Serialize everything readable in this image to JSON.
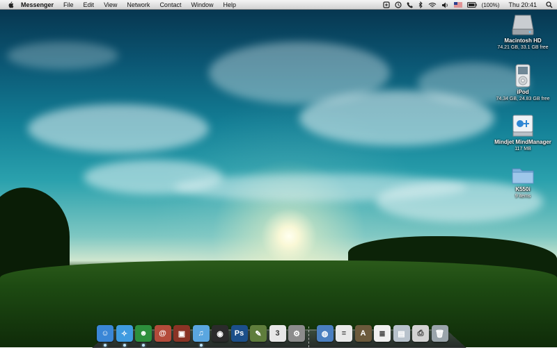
{
  "menubar": {
    "app_name": "Messenger",
    "menus": [
      "File",
      "Edit",
      "View",
      "Network",
      "Contact",
      "Window",
      "Help"
    ],
    "battery_label": "(100%)",
    "clock": "Thu 20:41"
  },
  "desktop_icons": [
    {
      "name": "Macintosh HD",
      "sub": "74.21 GB, 33.1 GB free",
      "icon": "hard-drive-icon"
    },
    {
      "name": "iPod",
      "sub": "74.34 GB, 24.83 GB free",
      "icon": "ipod-icon"
    },
    {
      "name": "Mindjet MindManager",
      "sub": "117 MB",
      "icon": "mindmanager-installer-icon"
    },
    {
      "name": "K550i",
      "sub": "9 items",
      "icon": "folder-icon"
    }
  ],
  "dock": {
    "apps": [
      {
        "id": "finder",
        "icon": "finder-icon",
        "glyph": "☺",
        "color": "#3a86d6",
        "running": true
      },
      {
        "id": "safari",
        "icon": "safari-icon",
        "glyph": "✧",
        "color": "#3f9be0",
        "running": true
      },
      {
        "id": "messenger",
        "icon": "messenger-icon",
        "glyph": "☻",
        "color": "#2d8f3c",
        "running": true
      },
      {
        "id": "address-book",
        "icon": "address-book-icon",
        "glyph": "@",
        "color": "#b44b3a",
        "running": false
      },
      {
        "id": "photo-booth",
        "icon": "photo-booth-icon",
        "glyph": "▣",
        "color": "#8a3325",
        "running": false
      },
      {
        "id": "itunes",
        "icon": "itunes-icon",
        "glyph": "♫",
        "color": "#5aa6e0",
        "running": true
      },
      {
        "id": "front-row",
        "icon": "front-row-icon",
        "glyph": "◉",
        "color": "#2b2b2b",
        "running": false
      },
      {
        "id": "photoshop",
        "icon": "photoshop-icon",
        "glyph": "Ps",
        "color": "#1c4f8a",
        "running": false
      },
      {
        "id": "notes",
        "icon": "notes-icon",
        "glyph": "✎",
        "color": "#5f7d3c",
        "running": false
      },
      {
        "id": "ical",
        "icon": "ical-icon",
        "glyph": "3",
        "color": "#e7e7e7",
        "running": false
      },
      {
        "id": "system-preferences",
        "icon": "gear-icon",
        "glyph": "⚙",
        "color": "#8c8c8c",
        "running": false
      }
    ],
    "others": [
      {
        "id": "stack",
        "icon": "stack-icon",
        "glyph": "◍",
        "color": "#4a7fc0"
      },
      {
        "id": "document",
        "icon": "document-icon",
        "glyph": "≡",
        "color": "#e9e9e9"
      },
      {
        "id": "applications",
        "icon": "applications-icon",
        "glyph": "A",
        "color": "#6c5a3c"
      },
      {
        "id": "text-document",
        "icon": "text-document-icon",
        "glyph": "≣",
        "color": "#f0f0f0"
      },
      {
        "id": "scanner",
        "icon": "scanner-icon",
        "glyph": "▤",
        "color": "#b8c2cc"
      },
      {
        "id": "printer",
        "icon": "printer-icon",
        "glyph": "⎙",
        "color": "#d3d3d3"
      },
      {
        "id": "trash",
        "icon": "trash-icon",
        "glyph": "🗑",
        "color": "#9aa4ab"
      }
    ]
  }
}
